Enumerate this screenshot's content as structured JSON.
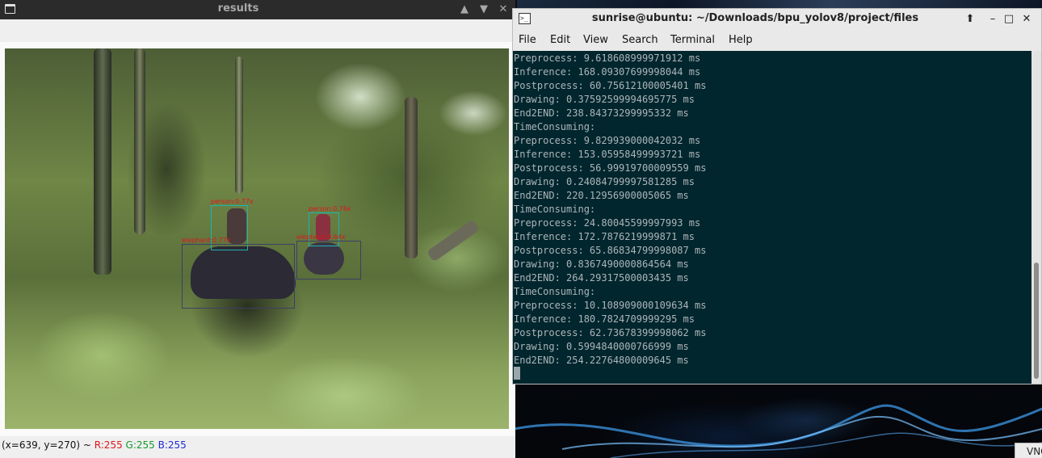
{
  "results_window": {
    "title": "results",
    "icon": "window-icon",
    "buttons": {
      "maximize": "▲",
      "restore": "▼",
      "close": "✕"
    },
    "detections": [
      {
        "label": "person:0.77x",
        "kind": "person"
      },
      {
        "label": "person:0.76x",
        "kind": "person"
      },
      {
        "label": "elephant:0.77x",
        "kind": "elephant"
      },
      {
        "label": "elephant:0.64x",
        "kind": "elephant"
      }
    ],
    "status": {
      "coords": "(x=639, y=270) ~ ",
      "r": "R:255",
      "g": "G:255",
      "b": "B:255"
    }
  },
  "terminal": {
    "title": "sunrise@ubuntu: ~/Downloads/bpu_yolov8/project/files",
    "menu": [
      "File",
      "Edit",
      "View",
      "Search",
      "Terminal",
      "Help"
    ],
    "buttons": {
      "new_tab": "⬆",
      "minimize": "–",
      "maximize": "□",
      "close": "✕"
    },
    "lines": [
      "Preprocess: 9.618608999971912 ms",
      "Inference: 168.09307699998044 ms",
      "Postprocess: 60.75612100005401 ms",
      "Drawing: 0.37592599994695775 ms",
      "End2END: 238.84373299995332 ms",
      "TimeConsuming:",
      "Preprocess: 9.829939000042032 ms",
      "Inference: 153.05958499993721 ms",
      "Postprocess: 56.99919700009559 ms",
      "Drawing: 0.24084799997581285 ms",
      "End2END: 220.12956900005065 ms",
      "TimeConsuming:",
      "Preprocess: 24.80045599997993 ms",
      "Inference: 172.7876219999871 ms",
      "Postprocess: 65.86834799998087 ms",
      "Drawing: 0.8367490000864564 ms",
      "End2END: 264.29317500003435 ms",
      "TimeConsuming:",
      "Preprocess: 10.108909000109634 ms",
      "Inference: 180.7824709999295 ms",
      "Postprocess: 62.73678399998062 ms",
      "Drawing: 0.5994840000766999 ms",
      "End2END: 254.22764800009645 ms"
    ]
  },
  "taskbar": {
    "vnc_label": "VNC"
  },
  "colors": {
    "terminal_bg": "#01262d",
    "terminal_fg": "#adb5ba",
    "detection_box": "#1fb3b3",
    "detection_label": "#e2141e"
  }
}
